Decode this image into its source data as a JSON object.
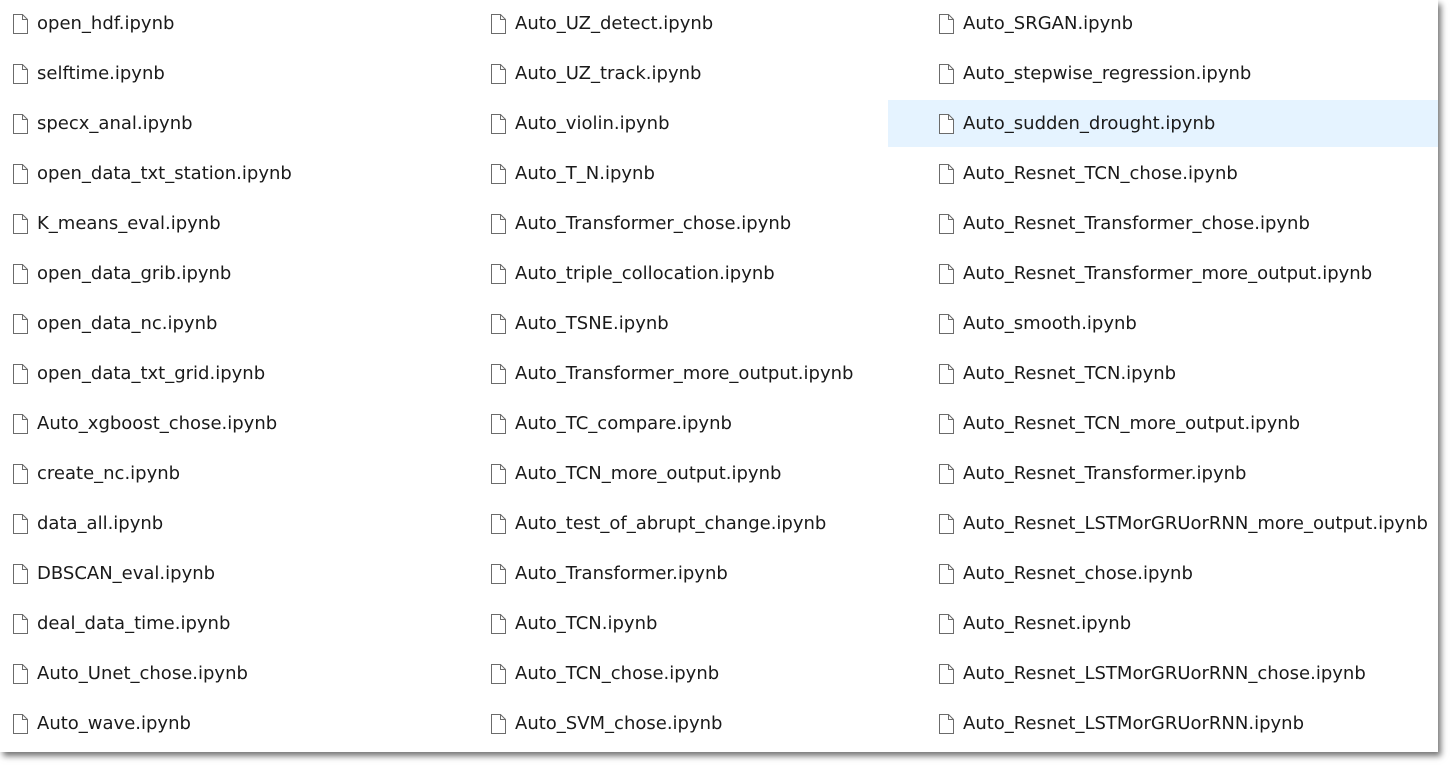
{
  "columns": [
    {
      "items": [
        {
          "name": "open_hdf.ipynb",
          "icon": "file-icon"
        },
        {
          "name": "selftime.ipynb",
          "icon": "file-icon"
        },
        {
          "name": "specx_anal.ipynb",
          "icon": "file-icon"
        },
        {
          "name": "open_data_txt_station.ipynb",
          "icon": "file-icon"
        },
        {
          "name": "K_means_eval.ipynb",
          "icon": "file-icon"
        },
        {
          "name": "open_data_grib.ipynb",
          "icon": "file-icon"
        },
        {
          "name": "open_data_nc.ipynb",
          "icon": "file-icon"
        },
        {
          "name": "open_data_txt_grid.ipynb",
          "icon": "file-icon"
        },
        {
          "name": "Auto_xgboost_chose.ipynb",
          "icon": "file-icon"
        },
        {
          "name": "create_nc.ipynb",
          "icon": "file-icon"
        },
        {
          "name": "data_all.ipynb",
          "icon": "file-icon"
        },
        {
          "name": "DBSCAN_eval.ipynb",
          "icon": "file-icon"
        },
        {
          "name": "deal_data_time.ipynb",
          "icon": "file-icon"
        },
        {
          "name": "Auto_Unet_chose.ipynb",
          "icon": "file-icon"
        },
        {
          "name": "Auto_wave.ipynb",
          "icon": "file-icon"
        }
      ]
    },
    {
      "items": [
        {
          "name": "Auto_UZ_detect.ipynb",
          "icon": "file-icon"
        },
        {
          "name": "Auto_UZ_track.ipynb",
          "icon": "file-icon"
        },
        {
          "name": "Auto_violin.ipynb",
          "icon": "file-icon"
        },
        {
          "name": "Auto_T_N.ipynb",
          "icon": "file-icon"
        },
        {
          "name": "Auto_Transformer_chose.ipynb",
          "icon": "file-icon"
        },
        {
          "name": "Auto_triple_collocation.ipynb",
          "icon": "file-icon"
        },
        {
          "name": "Auto_TSNE.ipynb",
          "icon": "file-icon"
        },
        {
          "name": "Auto_Transformer_more_output.ipynb",
          "icon": "file-icon"
        },
        {
          "name": "Auto_TC_compare.ipynb",
          "icon": "file-icon"
        },
        {
          "name": "Auto_TCN_more_output.ipynb",
          "icon": "file-icon"
        },
        {
          "name": "Auto_test_of_abrupt_change.ipynb",
          "icon": "file-icon"
        },
        {
          "name": "Auto_Transformer.ipynb",
          "icon": "file-icon"
        },
        {
          "name": "Auto_TCN.ipynb",
          "icon": "file-icon"
        },
        {
          "name": "Auto_TCN_chose.ipynb",
          "icon": "file-icon"
        },
        {
          "name": "Auto_SVM_chose.ipynb",
          "icon": "file-icon"
        }
      ]
    },
    {
      "items": [
        {
          "name": "Auto_SRGAN.ipynb",
          "icon": "file-icon"
        },
        {
          "name": "Auto_stepwise_regression.ipynb",
          "icon": "file-icon"
        },
        {
          "name": "Auto_sudden_drought.ipynb",
          "icon": "file-icon",
          "selected": true
        },
        {
          "name": "Auto_Resnet_TCN_chose.ipynb",
          "icon": "file-icon"
        },
        {
          "name": "Auto_Resnet_Transformer_chose.ipynb",
          "icon": "file-icon"
        },
        {
          "name": "Auto_Resnet_Transformer_more_output.ipynb",
          "icon": "file-icon"
        },
        {
          "name": "Auto_smooth.ipynb",
          "icon": "file-icon"
        },
        {
          "name": "Auto_Resnet_TCN.ipynb",
          "icon": "file-icon"
        },
        {
          "name": "Auto_Resnet_TCN_more_output.ipynb",
          "icon": "file-icon"
        },
        {
          "name": "Auto_Resnet_Transformer.ipynb",
          "icon": "file-icon"
        },
        {
          "name": "Auto_Resnet_LSTMorGRUorRNN_more_output.ipynb",
          "icon": "file-icon"
        },
        {
          "name": "Auto_Resnet_chose.ipynb",
          "icon": "file-icon"
        },
        {
          "name": "Auto_Resnet.ipynb",
          "icon": "file-icon"
        },
        {
          "name": "Auto_Resnet_LSTMorGRUorRNN_chose.ipynb",
          "icon": "file-icon"
        },
        {
          "name": "Auto_Resnet_LSTMorGRUorRNN.ipynb",
          "icon": "file-icon"
        }
      ]
    }
  ],
  "colors": {
    "selected_background": "#e5f3ff",
    "text": "#1a1a1a",
    "icon_stroke": "#6b6b6b"
  }
}
